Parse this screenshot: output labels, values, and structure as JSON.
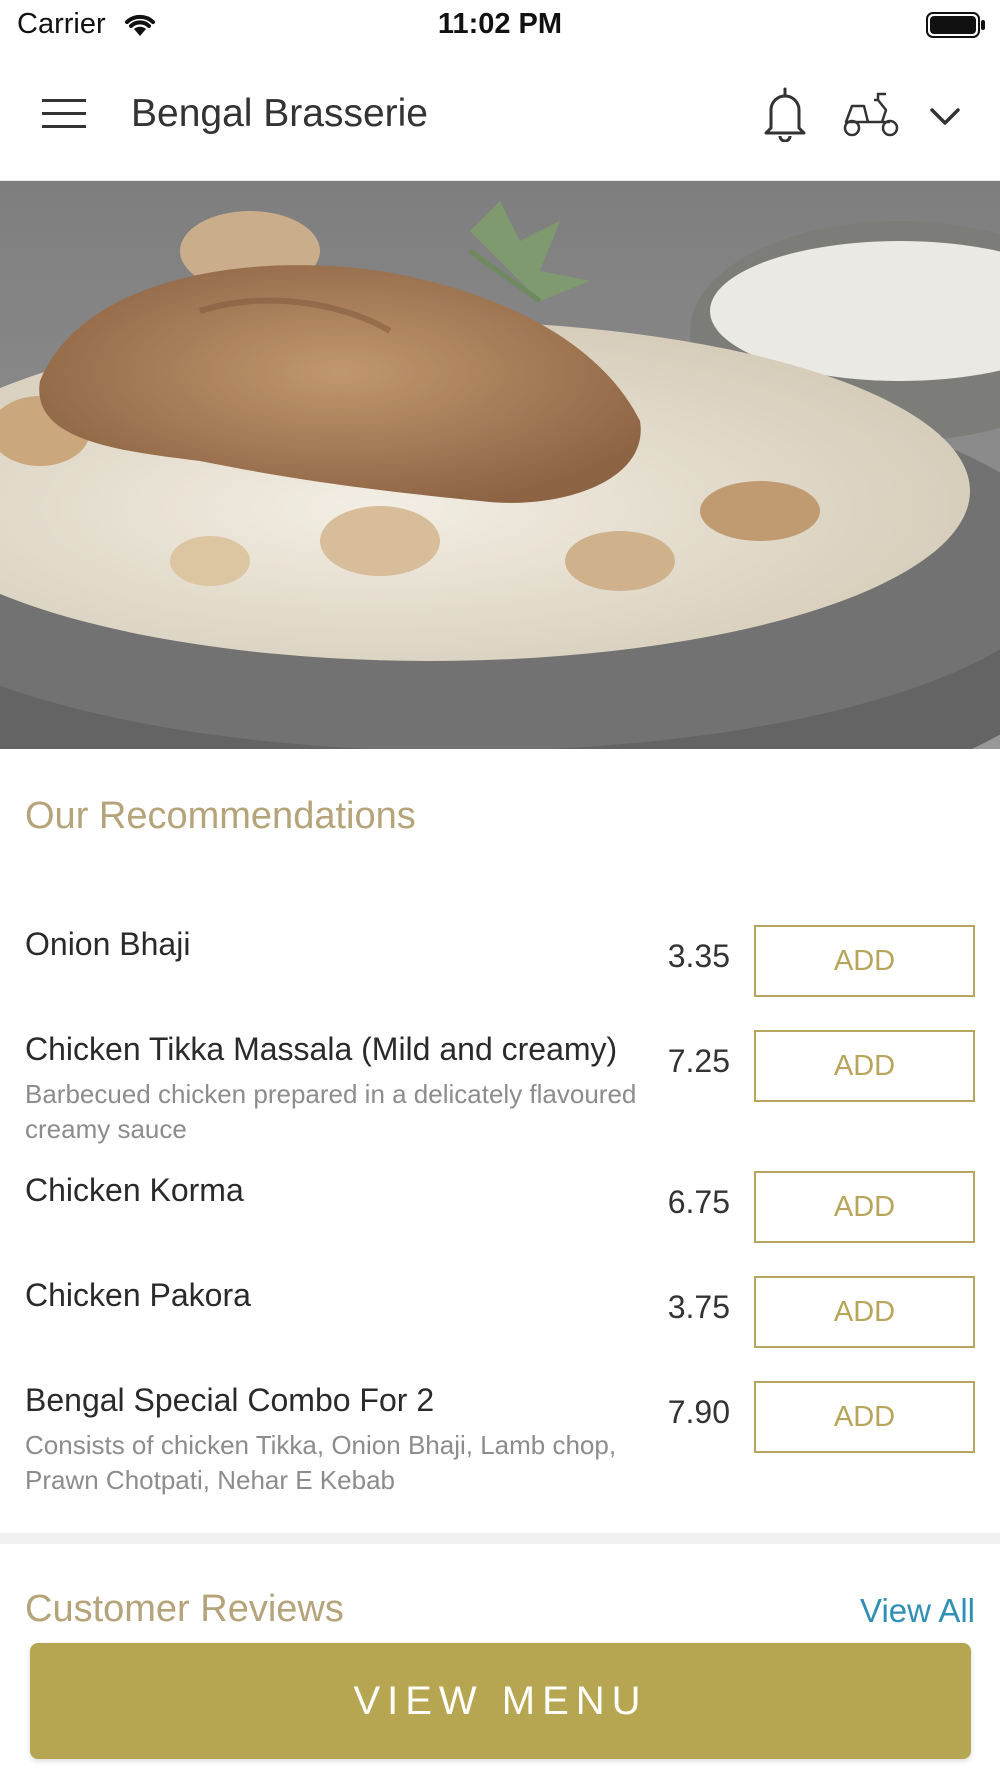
{
  "status_bar": {
    "carrier": "Carrier",
    "time": "11:02 PM",
    "icons": [
      "wifi-icon",
      "battery-icon"
    ]
  },
  "header": {
    "title": "Bengal Brasserie",
    "icons": [
      "hamburger-menu-icon",
      "bell-icon",
      "delivery-scooter-icon",
      "chevron-down-icon"
    ]
  },
  "hero": {
    "image": "biryani-dish-photo"
  },
  "recommendations": {
    "title": "Our Recommendations",
    "items": [
      {
        "name": "Onion Bhaji",
        "description": "",
        "price": "3.35",
        "button": "ADD"
      },
      {
        "name": "Chicken Tikka Massala (Mild and creamy)",
        "description": "Barbecued chicken prepared in a delicately flavoured creamy sauce",
        "price": "7.25",
        "button": "ADD"
      },
      {
        "name": "Chicken Korma",
        "description": "",
        "price": "6.75",
        "button": "ADD"
      },
      {
        "name": "Chicken Pakora",
        "description": "",
        "price": "3.75",
        "button": "ADD"
      },
      {
        "name": "Bengal Special Combo For 2",
        "description": "Consists of chicken Tikka, Onion Bhaji, Lamb chop, Prawn Chotpati, Nehar E Kebab",
        "price": "7.90",
        "button": "ADD"
      }
    ]
  },
  "reviews": {
    "title": "Customer Reviews",
    "view_all": "View All"
  },
  "footer": {
    "view_menu": "VIEW MENU"
  },
  "colors": {
    "accent_gold": "#b7a651",
    "section_title": "#b5a37a",
    "link_blue": "#2f8fb5"
  }
}
